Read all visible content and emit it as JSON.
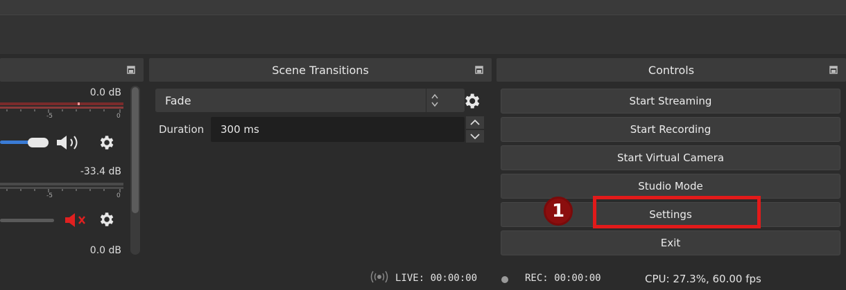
{
  "docks": {
    "scene_transitions_title": "Scene Transitions",
    "controls_title": "Controls"
  },
  "mixer": {
    "channel1_db": "0.0 dB",
    "channel1_tick_mid": "-5",
    "channel1_tick_end": "0",
    "channel2_db": "-33.4 dB",
    "channel2_tick_mid": "-5",
    "channel2_tick_end": "0",
    "channel3_db": "0.0 dB",
    "channel1_volume_icon": "speaker-icon",
    "channel2_volume_icon": "muted-speaker-icon"
  },
  "transitions": {
    "selected": "Fade",
    "duration_label": "Duration",
    "duration_value": "300 ms"
  },
  "controls": {
    "buttons": [
      "Start Streaming",
      "Start Recording",
      "Start Virtual Camera",
      "Studio Mode",
      "Settings",
      "Exit"
    ]
  },
  "annotation": {
    "step_number": "1",
    "highlight_color": "#e21a1a"
  },
  "status": {
    "live": "LIVE: 00:00:00",
    "rec": "REC: 00:00:00",
    "cpu": "CPU: 27.3%, 60.00 fps"
  },
  "colors": {
    "background": "#2b2b2b",
    "button": "#3c3c3c",
    "accent_blue": "#3a7bd5",
    "mute_red": "#e02020"
  }
}
